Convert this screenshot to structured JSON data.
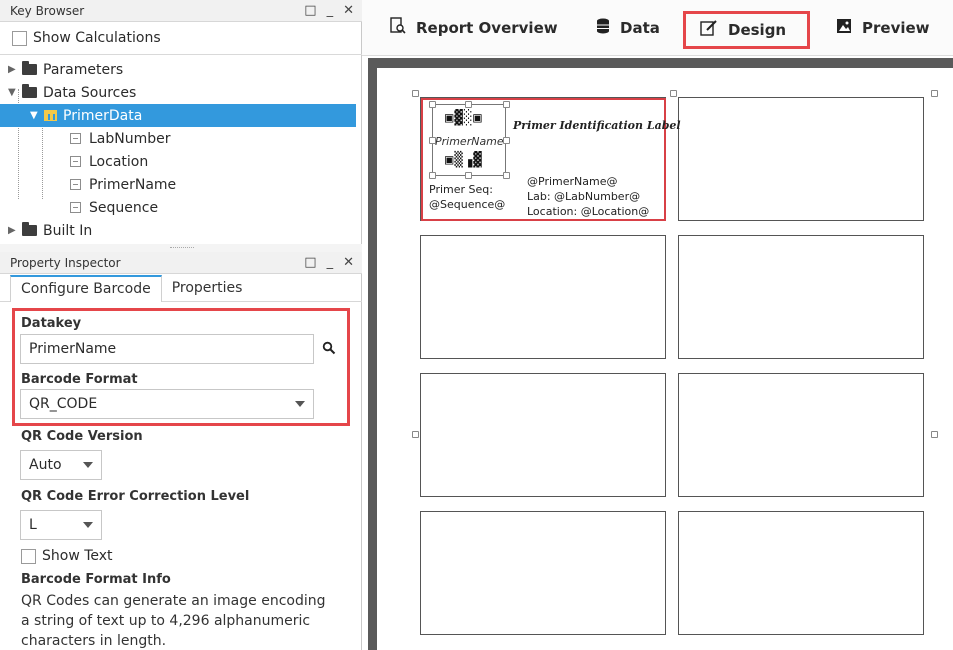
{
  "key_browser": {
    "title": "Key Browser",
    "controls": {
      "restore": "□",
      "minimize": "_",
      "close": "✕"
    },
    "show_calculations": "Show Calculations",
    "tree": [
      {
        "label": "Parameters",
        "type": "folder",
        "expanded": false
      },
      {
        "label": "Data Sources",
        "type": "folder",
        "expanded": true
      },
      {
        "label": "PrimerData",
        "type": "table",
        "selected": true
      },
      {
        "label": "LabNumber",
        "type": "field"
      },
      {
        "label": "Location",
        "type": "field"
      },
      {
        "label": "PrimerName",
        "type": "field"
      },
      {
        "label": "Sequence",
        "type": "field"
      },
      {
        "label": "Built In",
        "type": "folder",
        "expanded": false
      }
    ]
  },
  "property_inspector": {
    "title": "Property Inspector",
    "tabs": [
      "Configure Barcode",
      "Properties"
    ],
    "datakey_label": "Datakey",
    "datakey_value": "PrimerName",
    "format_label": "Barcode Format",
    "format_value": "QR_CODE",
    "qr_version_label": "QR Code Version",
    "qr_version_value": "Auto",
    "error_level_label": "QR Code Error Correction Level",
    "error_level_value": "L",
    "show_text": "Show Text",
    "info_label": "Barcode Format Info",
    "info_lines": [
      "QR Codes can generate an image encoding",
      "a string of text up to 4,296 alphanumeric",
      "characters in length."
    ]
  },
  "toolbar": {
    "tabs": [
      {
        "label": "Report Overview",
        "icon": "report-overview-icon"
      },
      {
        "label": "Data",
        "icon": "database-icon"
      },
      {
        "label": "Design",
        "icon": "design-edit-icon",
        "selected": true
      },
      {
        "label": "Preview",
        "icon": "image-icon"
      }
    ]
  },
  "label": {
    "title": "Primer Identification Label",
    "qr_name": "PrimerName",
    "qr_top": "▣▓░▣",
    "qr_bottom": "▣▒▗▓",
    "seq_line1": "Primer Seq:",
    "seq_line2": "@Sequence@",
    "name_line": "@PrimerName@",
    "lab_line": "Lab: @LabNumber@",
    "location_line": "Location: @Location@"
  },
  "colors": {
    "accent": "#3399dd",
    "highlight": "#e5464a",
    "canvas": "#5a5a5a"
  }
}
